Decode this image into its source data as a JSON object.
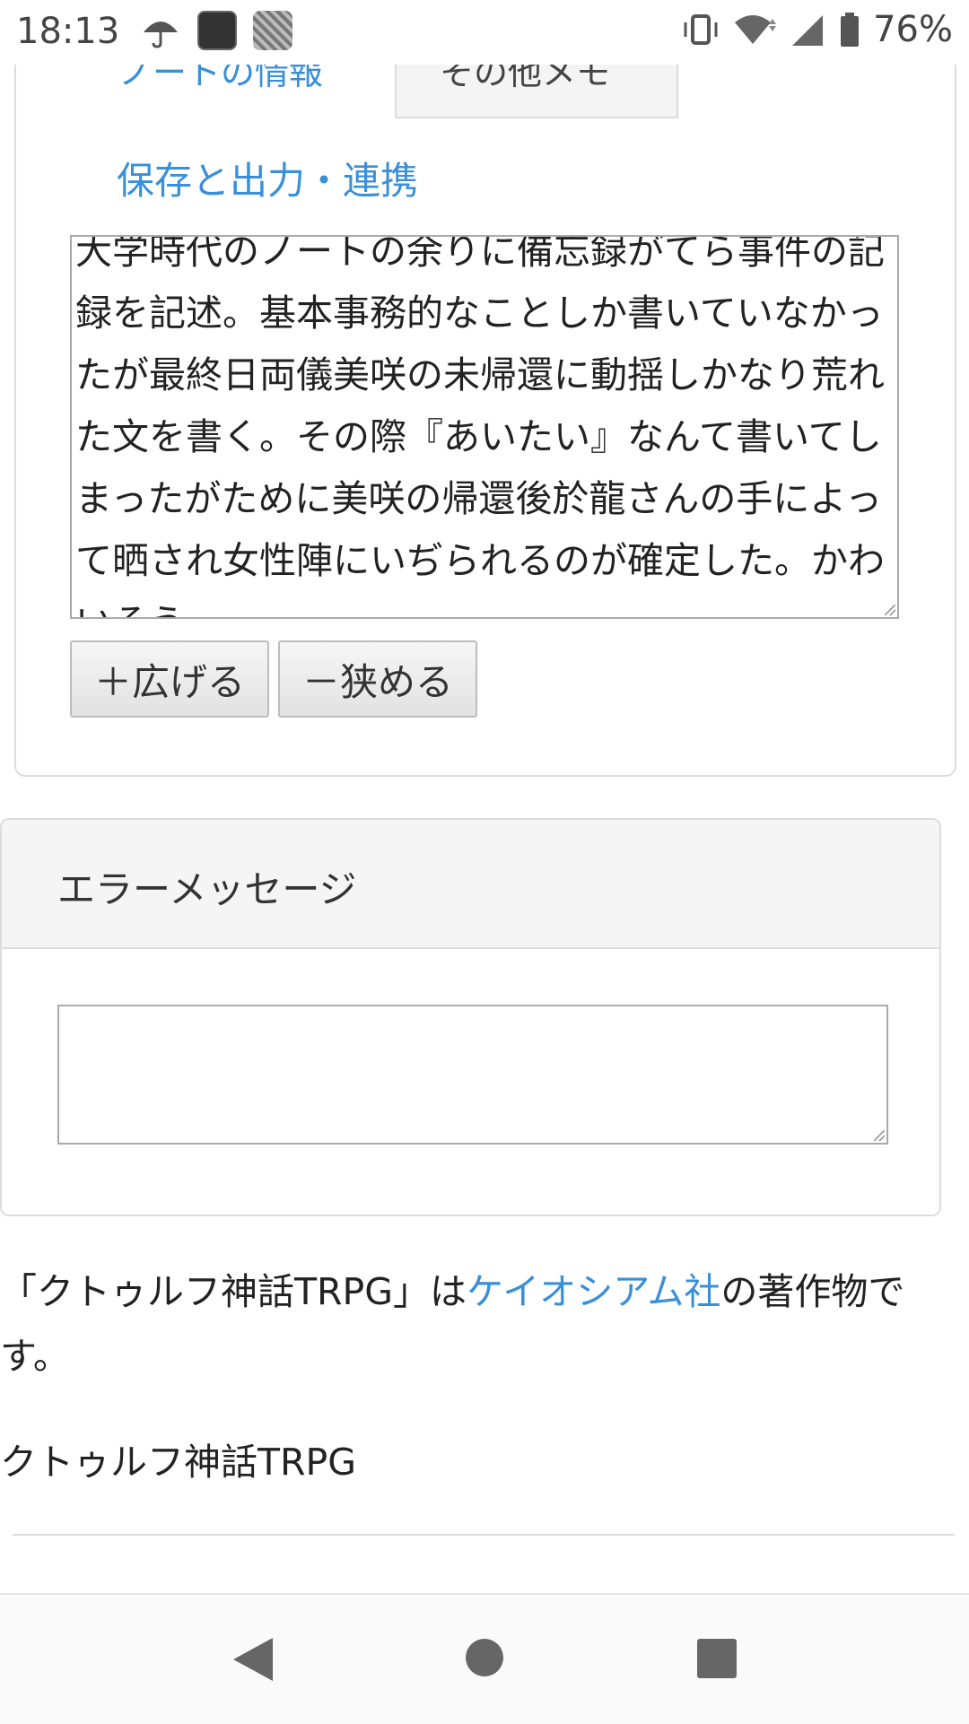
{
  "status_bar": {
    "time": "18:13",
    "battery": "76%",
    "icons": [
      "umbrella-icon",
      "app-quest-icon",
      "app-manga-icon",
      "vibrate-icon",
      "wifi-icon",
      "signal-icon",
      "battery-icon"
    ]
  },
  "tabs": {
    "note_info": "ノートの情報",
    "other_memo": "その他メモ",
    "save_export": "保存と出力・連携"
  },
  "memo": {
    "text": "大学時代のノートの余りに備忘録がてら事件の記録を記述。基本事務的なことしか書いていなかったが最終日両儀美咲の未帰還に動揺しかなり荒れた文を書く。その際『あいたい』なんて書いてしまったがために美咲の帰還後於龍さんの手によって晒され女性陣にいぢられるのが確定した。かわいそう"
  },
  "buttons": {
    "widen": "＋広げる",
    "narrow": "－狭める"
  },
  "error_panel": {
    "title": "エラーメッセージ",
    "value": ""
  },
  "footer": {
    "notice_prefix": "「クトゥルフ神話TRPG」は",
    "notice_link": "ケイオシアム社",
    "notice_suffix": "の著作物です。",
    "system_title": "クトゥルフ神話TRPG"
  },
  "colors": {
    "link": "#3a8fd9",
    "panel_border": "#dcdcdc",
    "panel_header_bg": "#f5f5f5"
  },
  "nav": {
    "back": "back-icon",
    "home": "home-icon",
    "recents": "recents-icon"
  }
}
